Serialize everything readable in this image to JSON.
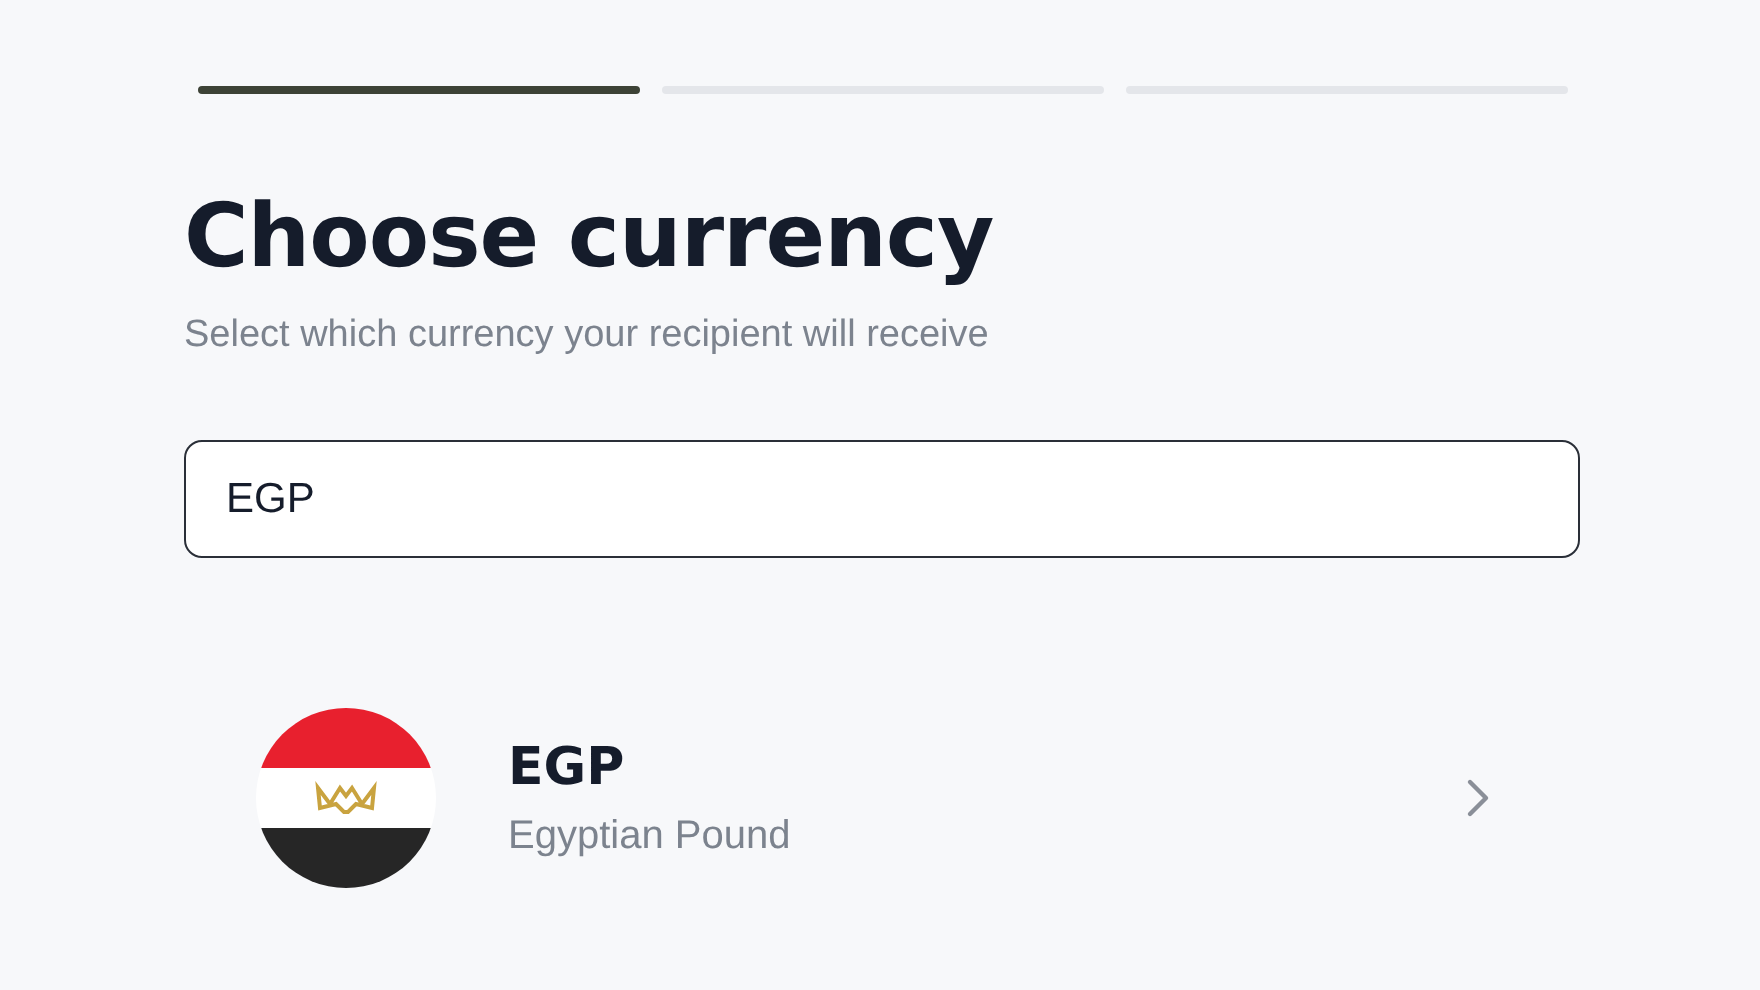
{
  "progress_steps": [
    {
      "complete": true
    },
    {
      "complete": false
    },
    {
      "complete": false
    }
  ],
  "title": "Choose currency",
  "subtitle": "Select which currency your recipient will receive",
  "search": {
    "value": "EGP"
  },
  "results": [
    {
      "code": "EGP",
      "name": "Egyptian Pound",
      "kind": "egypt"
    }
  ]
}
